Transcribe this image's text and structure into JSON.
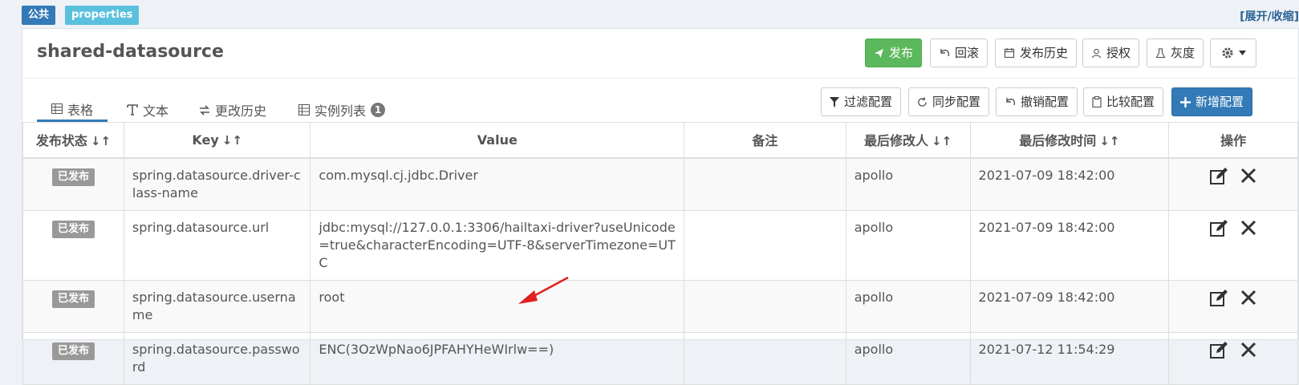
{
  "tags": {
    "public": "公共",
    "format": "properties"
  },
  "expand_toggle": "[展开/收缩]",
  "namespace": {
    "title": "shared-datasource"
  },
  "actions": {
    "publish": "发布",
    "rollback": "回滚",
    "publish_history": "发布历史",
    "authorize": "授权",
    "gray": "灰度"
  },
  "tabs": [
    {
      "label": "表格",
      "icon": "table-icon"
    },
    {
      "label": "文本",
      "icon": "text-icon"
    },
    {
      "label": "更改历史",
      "icon": "history-icon"
    },
    {
      "label": "实例列表",
      "icon": "instances-icon",
      "badge": "1"
    }
  ],
  "toolbar": {
    "filter": "过滤配置",
    "sync": "同步配置",
    "revoke": "撤销配置",
    "compare": "比较配置",
    "add": "新增配置"
  },
  "table": {
    "headers": [
      "发布状态",
      "Key",
      "Value",
      "备注",
      "最后修改人",
      "最后修改时间",
      "操作"
    ],
    "sort_glyph": "↓↑",
    "rows": [
      {
        "status": "已发布",
        "key": "spring.datasource.driver-class-name",
        "value": "com.mysql.cj.jdbc.Driver",
        "comment": "",
        "modifier": "apollo",
        "time": "2021-07-09 18:42:00"
      },
      {
        "status": "已发布",
        "key": "spring.datasource.url",
        "value": "jdbc:mysql://127.0.0.1:3306/hailtaxi-driver?useUnicode=true&characterEncoding=UTF-8&serverTimezone=UTC",
        "comment": "",
        "modifier": "apollo",
        "time": "2021-07-09 18:42:00"
      },
      {
        "status": "已发布",
        "key": "spring.datasource.username",
        "value": "root",
        "comment": "",
        "modifier": "apollo",
        "time": "2021-07-09 18:42:00"
      },
      {
        "status": "已发布",
        "key": "spring.datasource.password",
        "value": "ENC(3OzWpNao6JPFAHYHeWIrlw==)",
        "comment": "",
        "modifier": "apollo",
        "time": "2021-07-12 11:54:29"
      }
    ]
  },
  "colors": {
    "publish_green": "#5cb85c",
    "primary_blue": "#337ab7",
    "annotation_red": "#e02020"
  }
}
